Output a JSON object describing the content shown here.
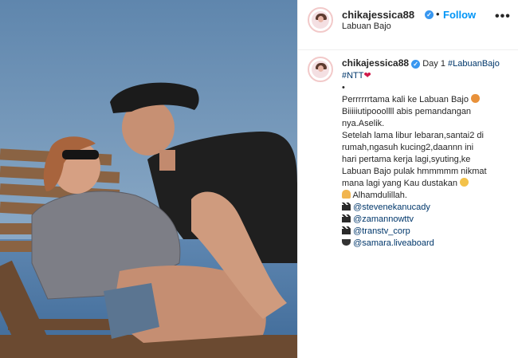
{
  "post": {
    "username": "chikajessica88",
    "separator": "•",
    "follow_label": "Follow",
    "location": "Labuan Bajo",
    "more_label": "•••"
  },
  "caption": {
    "username": "chikajessica88",
    "line1_text": "Day 1 ",
    "line1_tag": "#LabuanBajo",
    "line2_tag": "#NTT",
    "bullet": "•",
    "line3": "Perrrrrrtama kali ke Labuan Bajo",
    "line4": "Biiiiiutipooollll abis pemandangan",
    "line5": "nya.Aselik.",
    "line6": "Setelah lama libur lebaran,santai2 di",
    "line7": "rumah,ngasuh kucing2,daannn ini",
    "line8": "hari pertama kerja lagi,syuting,ke",
    "line9": "Labuan Bajo pulak hmmmmm nikmat",
    "line10": "mana lagi yang Kau dustakan",
    "line11": " Alhamdulillah.",
    "mention1": "@stevenekanucady",
    "mention2": "@zamannowttv",
    "mention3": "@transtv_corp",
    "mention4": "@samara.liveaboard"
  },
  "icons": [
    "verified-badge-icon",
    "heart-icon",
    "smiling-cat-icon",
    "grinning-face-icon",
    "praying-hands-icon",
    "clapperboard-icon",
    "ship-icon",
    "more-options-icon"
  ],
  "colors": {
    "link": "#0095f6",
    "tag": "#00376b",
    "text": "#262626",
    "verified": "#3897f0"
  }
}
